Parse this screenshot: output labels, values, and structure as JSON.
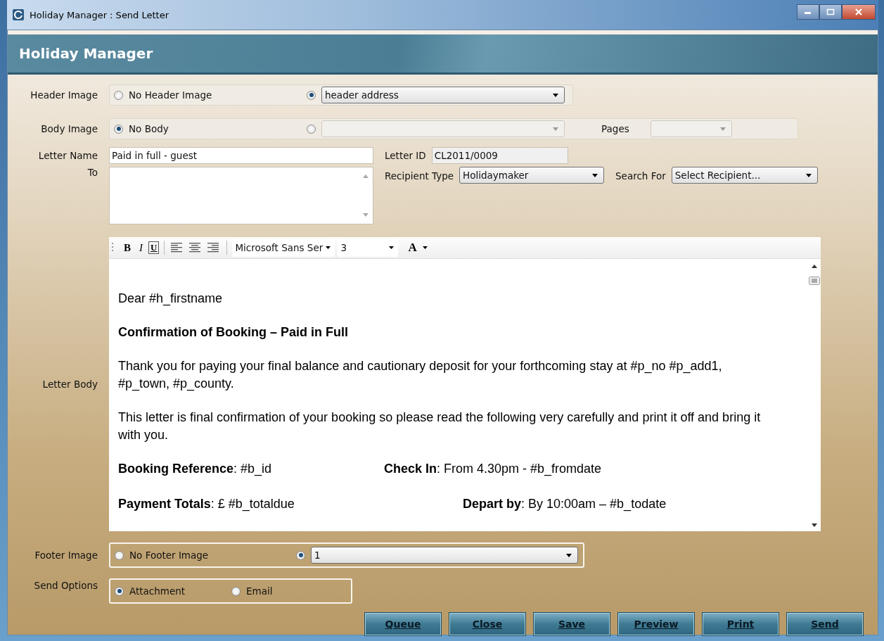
{
  "window": {
    "title": "Holiday Manager : Send Letter"
  },
  "banner": {
    "title": "Holiday Manager"
  },
  "header_image": {
    "label": "Header Image",
    "none_option": {
      "label": "No Header Image",
      "selected": false
    },
    "image_option": {
      "selected": true,
      "value": "header address"
    }
  },
  "body_image": {
    "label": "Body Image",
    "none_option": {
      "label": "No Body",
      "selected": true
    },
    "image_option": {
      "selected": false,
      "disabled": true
    },
    "pages_label": "Pages"
  },
  "letter_name": {
    "label": "Letter Name",
    "value": "Paid in full - guest"
  },
  "letter_id": {
    "label": "Letter ID",
    "value": "CL2011/0009"
  },
  "to": {
    "label": "To"
  },
  "recipient_type": {
    "label": "Recipient Type",
    "value": "Holidaymaker"
  },
  "search_for": {
    "label": "Search For",
    "value": "Select Recipient..."
  },
  "editor": {
    "label": "Letter Body",
    "toolbar": {
      "bold": "B",
      "italic": "I",
      "underline": "U",
      "font": "Microsoft Sans Ser",
      "size": "3",
      "color_glyph": "A"
    },
    "paragraphs": [
      {
        "kind": "text",
        "text": "Dear #h_firstname"
      },
      {
        "kind": "heading",
        "text": "Confirmation of Booking – Paid in Full"
      },
      {
        "kind": "text",
        "text": "Thank you for paying your final balance and cautionary deposit for your forthcoming stay at #p_no #p_add1, #p_town, #p_county."
      },
      {
        "kind": "text",
        "text": "This letter is final confirmation of your booking so please read the following very carefully and print it off and bring it with you."
      },
      {
        "kind": "pair",
        "left": "**Booking Reference**: #b_id",
        "right": "**Check In**: From 4.30pm - #b_fromdate"
      },
      {
        "kind": "pair",
        "left": "**Payment Totals**: £ #b_totaldue",
        "right": "**Depart by**: By 10:00am – #b_todate"
      }
    ]
  },
  "footer_image": {
    "label": "Footer Image",
    "none_option": {
      "label": "No Footer Image",
      "selected": false
    },
    "image_option": {
      "selected": true,
      "value": "1"
    }
  },
  "send_options": {
    "label": "Send Options",
    "options": [
      {
        "label": "Attachment",
        "selected": true
      },
      {
        "label": "Email",
        "selected": false
      }
    ]
  },
  "buttons": [
    "Queue",
    "Close",
    "Save",
    "Preview",
    "Print",
    "Send"
  ]
}
